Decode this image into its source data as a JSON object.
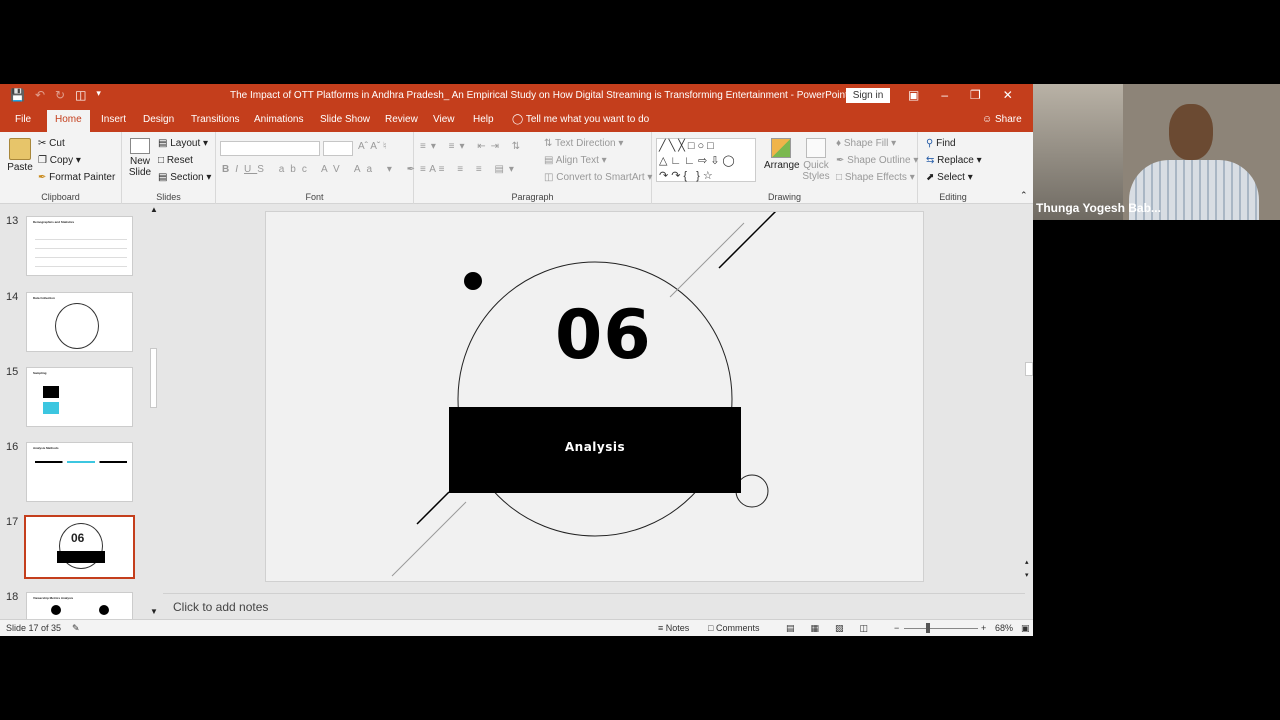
{
  "app": {
    "title": "The Impact of OTT Platforms in Andhra Pradesh_ An Empirical Study on How Digital Streaming is Transforming Entertainment  -  PowerPoint",
    "sign_in": "Sign in",
    "share": "Share",
    "tell_me": "Tell me what you want to do"
  },
  "tabs": [
    "File",
    "Home",
    "Insert",
    "Design",
    "Transitions",
    "Animations",
    "Slide Show",
    "Review",
    "View",
    "Help"
  ],
  "ribbon": {
    "clipboard": {
      "label": "Clipboard",
      "paste": "Paste",
      "cut": "Cut",
      "copy": "Copy",
      "format_painter": "Format Painter"
    },
    "slides": {
      "label": "Slides",
      "new_slide_1": "New",
      "new_slide_2": "Slide",
      "layout": "Layout",
      "reset": "Reset",
      "section": "Section"
    },
    "font": {
      "label": "Font"
    },
    "paragraph": {
      "label": "Paragraph",
      "text_direction": "Text Direction",
      "align_text": "Align Text",
      "smartart": "Convert to SmartArt"
    },
    "drawing": {
      "label": "Drawing",
      "arrange": "Arrange",
      "quick_styles_1": "Quick",
      "quick_styles_2": "Styles",
      "shape_fill": "Shape Fill",
      "shape_outline": "Shape Outline",
      "shape_effects": "Shape Effects"
    },
    "editing": {
      "label": "Editing",
      "find": "Find",
      "replace": "Replace",
      "select": "Select"
    }
  },
  "thumbnails": [
    {
      "num": "13",
      "title": "Demographics and Statistics"
    },
    {
      "num": "14",
      "title": "Data Collection"
    },
    {
      "num": "15",
      "title": "Sampling"
    },
    {
      "num": "16",
      "title": "Analysis Methods"
    },
    {
      "num": "17",
      "title": "06"
    },
    {
      "num": "18",
      "title": "Viewership Metrics Analysis"
    }
  ],
  "slide": {
    "number": "06",
    "caption": "Analysis"
  },
  "notes_placeholder": "Click to add notes",
  "status": {
    "slide_of": "Slide 17 of 35",
    "notes": "Notes",
    "comments": "Comments",
    "zoom": "68%"
  },
  "video": {
    "participant": "Thunga Yogesh Bab..."
  }
}
